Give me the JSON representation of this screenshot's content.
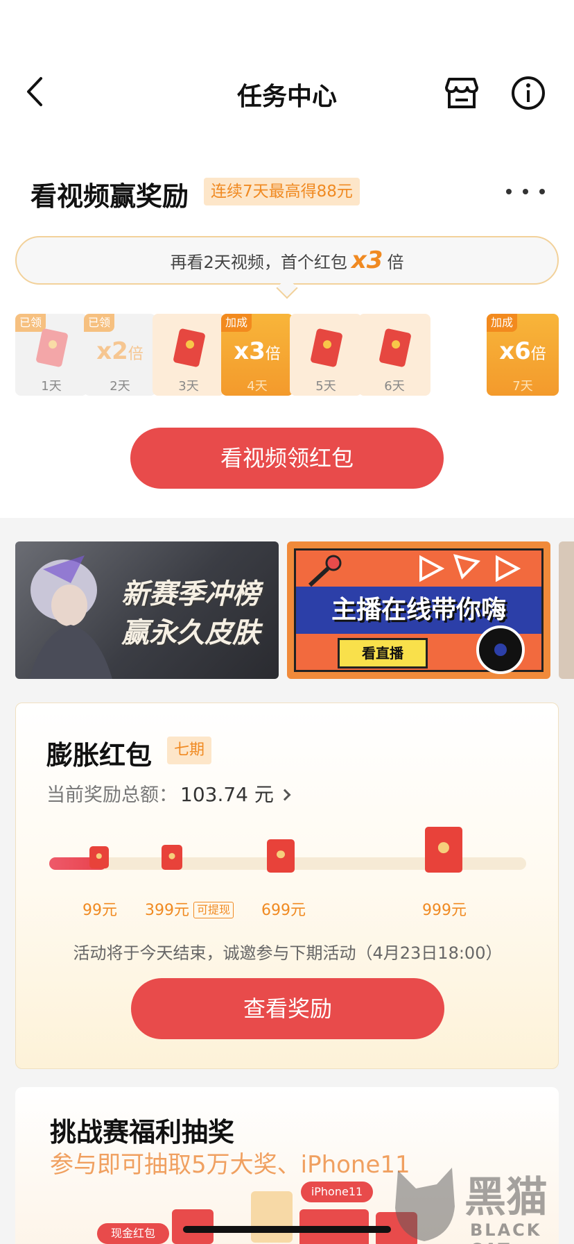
{
  "header": {
    "title": "任务中心",
    "back_icon": "chevron-left-icon",
    "store_icon": "store-icon",
    "info_icon": "info-icon"
  },
  "video_reward": {
    "title": "看视频赢奖励",
    "badge": "连续7天最高得88元",
    "tip_prefix": "再看2天视频，首个红包",
    "tip_multiplier": "x3",
    "tip_suffix": "倍",
    "days": [
      {
        "label": "1天",
        "tag": "已领",
        "state": "claimed",
        "mult": "",
        "unit": ""
      },
      {
        "label": "2天",
        "tag": "已领",
        "state": "claimed",
        "mult": "x2",
        "unit": "倍"
      },
      {
        "label": "3天",
        "tag": "",
        "state": "normal",
        "mult": "",
        "unit": ""
      },
      {
        "label": "4天",
        "tag": "加成",
        "state": "bonus",
        "mult": "x3",
        "unit": "倍"
      },
      {
        "label": "5天",
        "tag": "",
        "state": "normal",
        "mult": "",
        "unit": ""
      },
      {
        "label": "6天",
        "tag": "",
        "state": "normal",
        "mult": "",
        "unit": ""
      },
      {
        "label": "7天",
        "tag": "加成",
        "state": "bonus",
        "mult": "x6",
        "unit": "倍"
      }
    ],
    "button": "看视频领红包"
  },
  "banners": [
    {
      "text_line1": "新赛季冲榜",
      "text_line2": "赢永久皮肤"
    },
    {
      "title": "主播在线带你嗨",
      "button": "看直播"
    }
  ],
  "inflate": {
    "title": "膨胀红包",
    "tag": "七期",
    "total_label": "当前奖励总额：",
    "total_value": "103.74 元",
    "progress_fraction": 0.12,
    "milestones": [
      {
        "label": "99元",
        "chip": ""
      },
      {
        "label": "399元",
        "chip": "可提现"
      },
      {
        "label": "699元",
        "chip": ""
      },
      {
        "label": "999元",
        "chip": ""
      }
    ],
    "notice": "活动将于今天结束，诚邀参与下期活动（4月23日18:00）",
    "button": "查看奖励"
  },
  "challenge": {
    "title": "挑战赛福利抽奖",
    "subtitle": "参与即可抽取5万大奖、iPhone11",
    "iphone_tag": "iPhone11",
    "cash_tag": "现金红包"
  },
  "watermark": {
    "main": "黑猫",
    "sub": "BLACK CAT"
  },
  "colors": {
    "accent_red": "#e84b4b",
    "accent_orange": "#f08a22",
    "badge_bg": "#fde6c9"
  }
}
